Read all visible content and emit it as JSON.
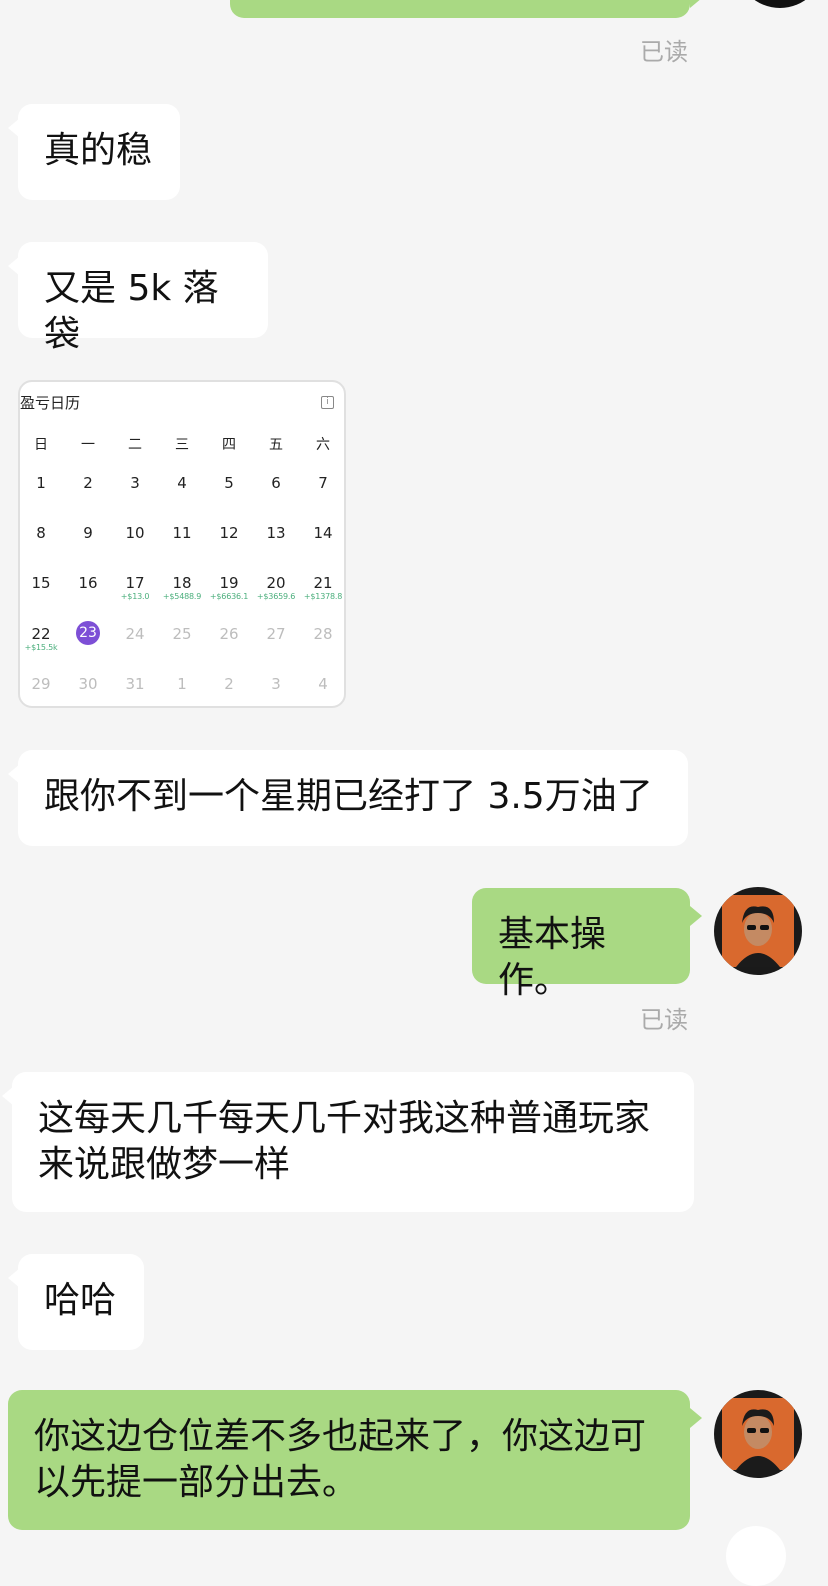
{
  "messages": {
    "top_read": "已读",
    "m1": "真的稳",
    "m2": "又是 5k 落袋",
    "m3": "跟你不到一个星期已经打了 3.5万油了",
    "m4": "基本操作。",
    "m4_read": "已读",
    "m5_line1": "这每天几千每天几千对我这种普通玩家",
    "m5_line2": "来说跟做梦一样",
    "m6": "哈哈",
    "m7_line1": "你这边仓位差不多也起来了，你这边可",
    "m7_line2": "以先提一部分出去。"
  },
  "calendar": {
    "title": "盈亏日历",
    "weekdays": [
      "日",
      "一",
      "二",
      "三",
      "四",
      "五",
      "六"
    ],
    "rows": [
      [
        "1",
        "2",
        "3",
        "4",
        "5",
        "6",
        "7"
      ],
      [
        "8",
        "9",
        "10",
        "11",
        "12",
        "13",
        "14"
      ],
      [
        "15",
        "16",
        "17",
        "18",
        "19",
        "20",
        "21"
      ],
      [
        "22",
        "23",
        "24",
        "25",
        "26",
        "27",
        "28"
      ],
      [
        "29",
        "30",
        "31",
        "1",
        "2",
        "3",
        "4"
      ]
    ],
    "pnl": {
      "17": "+$13.0",
      "18": "+$5488.9",
      "19": "+$6636.1",
      "20": "+$3659.6",
      "21": "+$1378.8",
      "22": "+$15.5k"
    },
    "today": "23",
    "today_color": "#7d4fd6",
    "pnl_color": "#4caf7d"
  },
  "colors": {
    "background": "#f5f5f5",
    "incoming_bubble": "#ffffff",
    "outgoing_bubble": "#a9d983"
  }
}
